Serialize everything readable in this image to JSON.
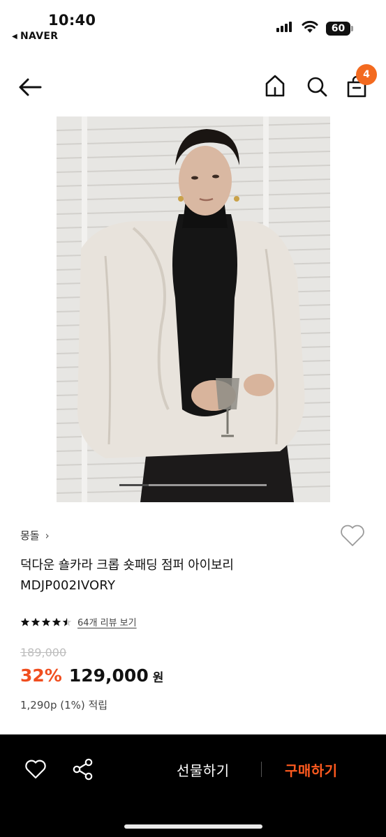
{
  "status_bar": {
    "time": "10:40",
    "back_app": "NAVER",
    "battery": "60"
  },
  "nav": {
    "back_icon": "arrow-left-icon",
    "home_icon": "home-icon",
    "search_icon": "search-icon",
    "cart_icon": "shopping-bag-icon",
    "cart_count": "4"
  },
  "product": {
    "image_alt": "crop padding jumper photo",
    "brand": "몽돌",
    "title": "덕다운 숄카라 크롭 숏패딩 점퍼 아이보리",
    "code": "MDJP002IVORY",
    "rating_stars": 4.5,
    "review_link": "64개 리뷰 보기",
    "original_price": "189,000",
    "discount": "32%",
    "sale_price": "129,000",
    "currency": "원",
    "points": "1,290p (1%) 적립",
    "image_position": "1"
  },
  "bottom_bar": {
    "wish_icon": "heart-outline-icon",
    "share_icon": "share-icon",
    "gift_label": "선물하기",
    "buy_label": "구매하기"
  },
  "colors": {
    "accent": "#f36a1f",
    "discount": "#f04e1f",
    "buy": "#ff5a1f",
    "bottom_bg": "#000000"
  }
}
